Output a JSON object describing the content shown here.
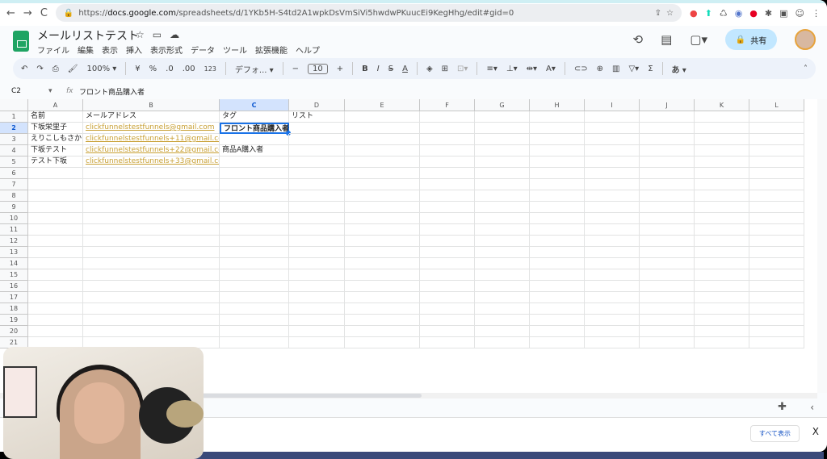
{
  "browser": {
    "url_prefix": "https://",
    "url_domain": "docs.google.com",
    "url_path": "/spreadsheets/d/1YKb5H-S4td2A1wpkDsVmSiVi5hwdwPKuucEi9KegHhg/edit#gid=0"
  },
  "doc": {
    "title": "メールリストテスト",
    "share_label": "共有"
  },
  "menu": [
    "ファイル",
    "編集",
    "表示",
    "挿入",
    "表示形式",
    "データ",
    "ツール",
    "拡張機能",
    "ヘルプ"
  ],
  "toolbar": {
    "zoom": "100%",
    "currency": "¥",
    "percent": "%",
    "dec_less": ".0",
    "dec_more": ".00",
    "format_123": "123",
    "font": "デフォ...",
    "font_size": "10",
    "input_mode": "あ"
  },
  "formula_bar": {
    "cell_ref": "C2",
    "fx": "fx",
    "value": "フロント商品購入者"
  },
  "columns": [
    "A",
    "B",
    "C",
    "D",
    "E",
    "F",
    "G",
    "H",
    "I",
    "J",
    "K",
    "L"
  ],
  "selected_column": "C",
  "selected_row": 2,
  "rows": [
    [
      "名前",
      "メールアドレス",
      "タグ",
      "リスト"
    ],
    [
      "下坂栄里子",
      "clickfunnelstestfunnels@gmail.com",
      "フロント商品購入者",
      ""
    ],
    [
      "えりこしもさか",
      "clickfunnelstestfunnels+11@gmail.com",
      "",
      ""
    ],
    [
      "下坂テスト",
      "clickfunnelstestfunnels+22@gmail.com",
      "商品A購入者",
      ""
    ],
    [
      "テスト下坂",
      "clickfunnelstestfunnels+33@gmail.com",
      "",
      ""
    ]
  ],
  "row_count": 21,
  "downloads": {
    "show_all": "すべて表示",
    "close": "X"
  }
}
